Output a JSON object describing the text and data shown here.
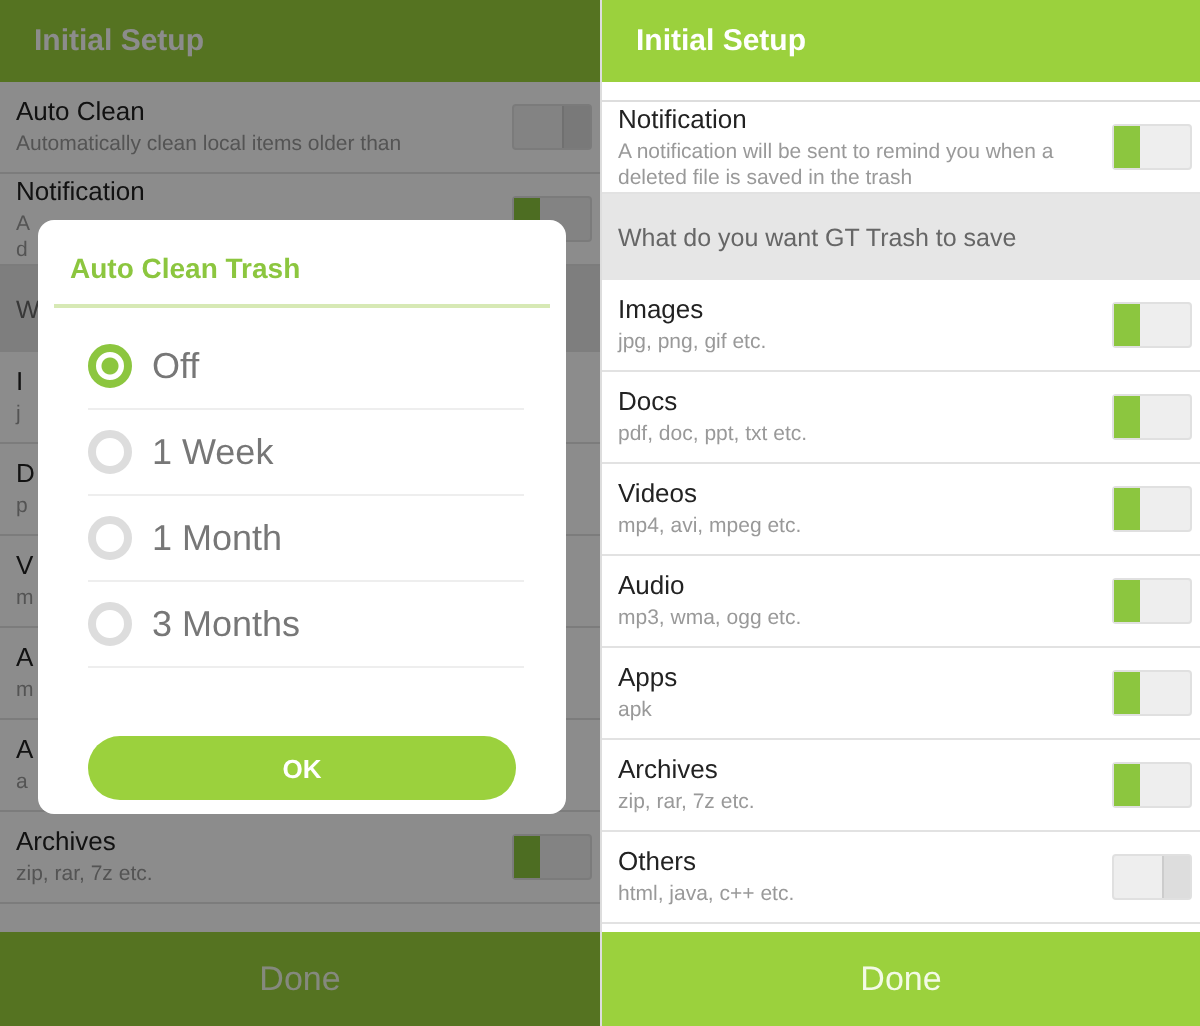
{
  "screens": [
    {
      "title": "Initial Setup",
      "dimmed": true,
      "scrolled": false,
      "rows": [
        {
          "kind": "setting",
          "title": "Auto Clean",
          "description": [
            "Automatically clean local items older than"
          ],
          "on": false
        },
        {
          "kind": "setting",
          "title": "Notification",
          "description": [
            "A",
            "d"
          ],
          "on": true
        },
        {
          "kind": "section",
          "label": "W"
        },
        {
          "kind": "setting",
          "title": "I",
          "description": [
            "j"
          ]
        },
        {
          "kind": "setting",
          "title": "D",
          "description": [
            "p"
          ]
        },
        {
          "kind": "setting",
          "title": "V",
          "description": [
            "m"
          ]
        },
        {
          "kind": "setting",
          "title": "A",
          "description": [
            "m"
          ]
        },
        {
          "kind": "setting",
          "title": "A",
          "description": [
            "a"
          ]
        },
        {
          "kind": "setting",
          "title": "Archives",
          "description": [
            "zip, rar, 7z etc."
          ],
          "on": true
        }
      ],
      "done": "Done",
      "dialog": {
        "title": "Auto Clean Trash",
        "options": [
          {
            "label": "Off",
            "selected": true
          },
          {
            "label": "1 Week",
            "selected": false
          },
          {
            "label": "1 Month",
            "selected": false
          },
          {
            "label": "3 Months",
            "selected": false
          }
        ],
        "button": "OK"
      }
    },
    {
      "title": "Initial Setup",
      "dimmed": false,
      "scrolled": true,
      "rows": [
        {
          "kind": "setting",
          "title": "Notification",
          "description": [
            "A notification will be sent to remind you when a",
            "deleted file is saved in the trash"
          ],
          "on": true
        },
        {
          "kind": "section",
          "label": "What do you want GT Trash to save"
        },
        {
          "kind": "setting",
          "title": "Images",
          "description": [
            "jpg, png, gif etc."
          ],
          "on": true
        },
        {
          "kind": "setting",
          "title": "Docs",
          "description": [
            "pdf, doc, ppt, txt etc."
          ],
          "on": true
        },
        {
          "kind": "setting",
          "title": "Videos",
          "description": [
            "mp4, avi, mpeg etc."
          ],
          "on": true
        },
        {
          "kind": "setting",
          "title": "Audio",
          "description": [
            "mp3, wma, ogg etc."
          ],
          "on": true
        },
        {
          "kind": "setting",
          "title": "Apps",
          "description": [
            "apk"
          ],
          "on": true
        },
        {
          "kind": "setting",
          "title": "Archives",
          "description": [
            "zip, rar, 7z etc."
          ],
          "on": true
        },
        {
          "kind": "setting",
          "title": "Others",
          "description": [
            "html, java, c++ etc."
          ],
          "on": false
        }
      ],
      "done": "Done"
    }
  ]
}
